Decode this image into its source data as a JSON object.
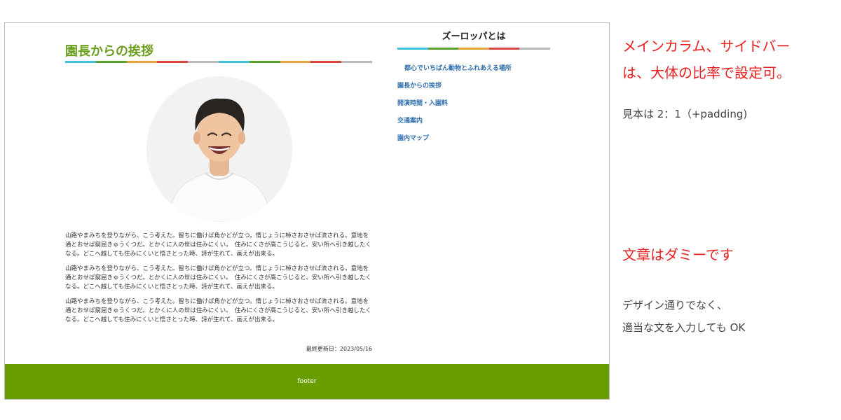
{
  "colors": {
    "title_green": "#6a9e1c",
    "link_blue": "#2f6fad",
    "footer_green": "#6a9e00",
    "note_red": "#e8201f",
    "stripe": [
      "#3fc1de",
      "#5aa02c",
      "#e8a23b",
      "#d9463d",
      "#b9b9b9"
    ]
  },
  "main": {
    "title": "園長からの挨拶",
    "portrait_icon": "smiling-man-photo",
    "paragraphs": [
      "山路やまみちを登りながら、こう考えた。智ちに働けば角かどが立つ。情じょうに棹さおさせば流される。意地を通とおせば窮屈きゅうくつだ。とかくに人の世は住みにくい。　住みにくさが高こうじると、安い所へ引き越したくなる。どこへ越しても住みにくいと悟さとった時、詩が生れて、画えが出来る。",
      "山路やまみちを登りながら、こう考えた。智ちに働けば角かどが立つ。情じょうに棹さおさせば流される。意地を通とおせば窮屈きゅうくつだ。とかくに人の世は住みにくい。　住みにくさが高こうじると、安い所へ引き越したくなる。どこへ越しても住みにくいと悟さとった時、詩が生れて、画えが出来る。",
      "山路やまみちを登りながら、こう考えた。智ちに働けば角かどが立つ。情じょうに棹さおさせば流される。意地を通とおせば窮屈きゅうくつだ。とかくに人の世は住みにくい。　住みにくさが高こうじると、安い所へ引き越したくなる。どこへ越しても住みにくいと悟さとった時、詩が生れて、画えが出来る。"
    ],
    "updated": "最終更新日：2023/05/16"
  },
  "sidebar": {
    "title": "ズーロッパとは",
    "items": [
      {
        "label": "都心でいちばん動物とふれあえる場所"
      },
      {
        "label": "園長からの挨拶"
      },
      {
        "label": "開演時間・入園料"
      },
      {
        "label": "交通案内"
      },
      {
        "label": "園内マップ"
      }
    ]
  },
  "footer": {
    "label": "footer"
  },
  "notes": {
    "layout_line1": "メインカラム、サイドバー",
    "layout_line2": "は、大体の比率で設定可。",
    "ratio": "見本は 2：1（+padding)",
    "dummy": "文章はダミーです",
    "free_line1": "デザイン通りでなく、",
    "free_line2": "適当な文を入力しても OK"
  }
}
